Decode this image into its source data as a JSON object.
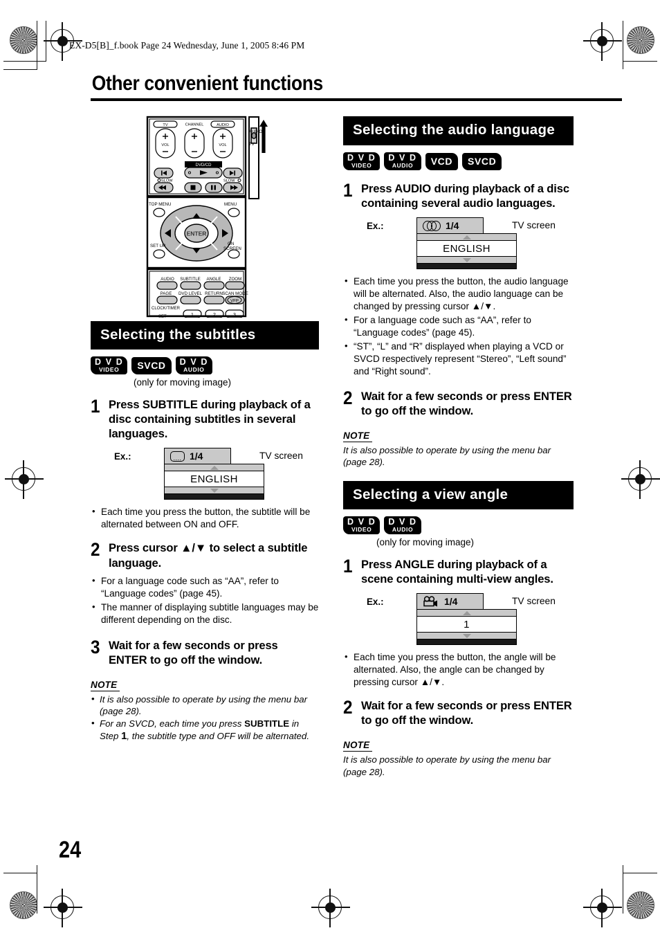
{
  "file_header": "EX-D5[B]_f.book  Page 24  Wednesday, June 1, 2005  8:46 PM",
  "page_title": "Other convenient functions",
  "page_number": "24",
  "remote": {
    "labels": {
      "tv": "TV",
      "channel": "CHANNEL",
      "audio": "AUDIO",
      "vol_left": "VOL",
      "vol_right": "VOL",
      "side_audio": "AUDIO",
      "side_tv": "TV",
      "dvdcd": "DVD/CD",
      "slow_left": "SLOW",
      "slow_right": "SLOW",
      "top_menu": "TOP MENU",
      "menu": "MENU",
      "set_up": "SET UP",
      "on_screen": "ON SCREEN",
      "enter": "ENTER",
      "audio_btn": "AUDIO",
      "subtitle_btn": "SUBTITLE",
      "angle_btn": "ANGLE",
      "zoom_btn": "ZOOM",
      "page_btn": "PAGE",
      "dvd_level_btn": "DVD LEVEL",
      "return_btn": "RETURN",
      "scan_mode_btn": "SCAN MODE",
      "vfp": "VFP",
      "clock_timer": "CLOCK/TIMER",
      "set": "SET",
      "num1": "1",
      "num2": "2",
      "num3": "3"
    }
  },
  "sections": [
    {
      "id": "subtitles",
      "heading": "Selecting the subtitles",
      "badges": [
        {
          "line1": "D V D",
          "line2": "VIDEO"
        },
        {
          "line1": "SVCD",
          "line2": ""
        },
        {
          "line1": "D V D",
          "line2": "AUDIO"
        }
      ],
      "only_note": "(only for moving image)",
      "steps": [
        {
          "num": "1",
          "text": "Press SUBTITLE during playback of a disc containing subtitles in several languages.",
          "example": {
            "ex_label": "Ex.:",
            "tv_label": "TV screen",
            "icon": "subtitle-icon",
            "count": "1/4",
            "value": "ENGLISH"
          },
          "bullets": [
            "Each time you press the button, the subtitle will be alternated between ON and OFF."
          ]
        },
        {
          "num": "2",
          "text": "Press cursor ▲/▼ to select a subtitle language.",
          "bullets": [
            "For a language code such as “AA”, refer to “Language codes” (page 45).",
            "The manner of displaying subtitle languages may be different depending on the disc."
          ]
        },
        {
          "num": "3",
          "text": "Wait for a few seconds or press ENTER to go off the window.",
          "bullets": []
        }
      ],
      "note": {
        "title": "NOTE",
        "items": [
          {
            "pre": "It is also possible to operate by using the menu bar (page 28).",
            "bold": "",
            "post": ""
          },
          {
            "pre": "For an SVCD, each time you press ",
            "bold": "SUBTITLE",
            "post": " in Step ",
            "stepnum": "1",
            "tail": ", the subtitle type and OFF will be alternated."
          }
        ]
      }
    },
    {
      "id": "audio-language",
      "heading": "Selecting the audio language",
      "badges": [
        {
          "line1": "D V D",
          "line2": "VIDEO"
        },
        {
          "line1": "D V D",
          "line2": "AUDIO"
        },
        {
          "line1": "VCD",
          "line2": ""
        },
        {
          "line1": "SVCD",
          "line2": ""
        }
      ],
      "only_note": "",
      "steps": [
        {
          "num": "1",
          "text": "Press AUDIO during playback of a disc containing several audio languages.",
          "example": {
            "ex_label": "Ex.:",
            "tv_label": "TV screen",
            "icon": "audio-icon",
            "count": "1/4",
            "value": "ENGLISH"
          },
          "bullets": [
            "Each time you press the button, the audio language will be alternated. Also, the audio language can be changed by pressing cursor ▲/▼.",
            "For a language code such as “AA”, refer to “Language codes” (page 45).",
            "“ST”, “L” and “R” displayed when playing a VCD or SVCD respectively represent “Stereo”, “Left sound” and “Right sound”."
          ]
        },
        {
          "num": "2",
          "text": "Wait for a few seconds or press ENTER to go off the window.",
          "bullets": []
        }
      ],
      "note": {
        "title": "NOTE",
        "body": "It is also possible to operate by using the menu bar (page 28)."
      }
    },
    {
      "id": "view-angle",
      "heading": "Selecting a view angle",
      "badges": [
        {
          "line1": "D V D",
          "line2": "VIDEO"
        },
        {
          "line1": "D V D",
          "line2": "AUDIO"
        }
      ],
      "only_note": "(only for moving image)",
      "steps": [
        {
          "num": "1",
          "text": "Press ANGLE during playback of a scene containing multi-view angles.",
          "example": {
            "ex_label": "Ex.:",
            "tv_label": "TV screen",
            "icon": "angle-camera-icon",
            "count": "1/4",
            "value": "1"
          },
          "bullets": [
            "Each time you press the button, the angle will be alternated. Also, the angle can be changed by pressing cursor ▲/▼."
          ]
        },
        {
          "num": "2",
          "text": "Wait for a few seconds or press ENTER to go off the window.",
          "bullets": []
        }
      ],
      "note": {
        "title": "NOTE",
        "body": "It is also possible to operate by using the menu bar (page 28)."
      }
    }
  ]
}
